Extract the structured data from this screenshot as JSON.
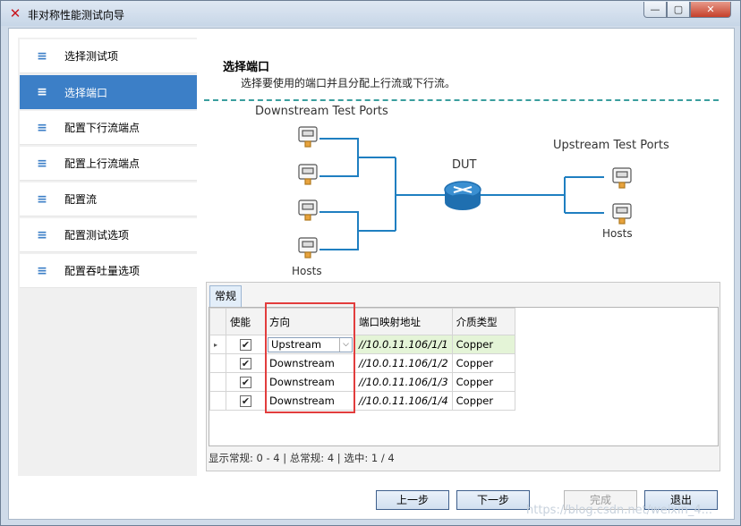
{
  "window": {
    "title": "非对称性能测试向导",
    "minimize": "—",
    "maximize": "▢",
    "close": "✕"
  },
  "sidebar": {
    "items": [
      {
        "label": "选择测试项"
      },
      {
        "label": "选择端口"
      },
      {
        "label": "配置下行流端点"
      },
      {
        "label": "配置上行流端点"
      },
      {
        "label": "配置流"
      },
      {
        "label": "配置测试选项"
      },
      {
        "label": "配置吞吐量选项"
      }
    ],
    "active_index": 1
  },
  "main": {
    "section_title": "选择端口",
    "section_desc": "选择要使用的端口并且分配上行流或下行流。",
    "diagram": {
      "downstream_label": "Downstream Test Ports",
      "upstream_label": "Upstream Test Ports",
      "dut_label": "DUT",
      "hosts_left": "Hosts",
      "hosts_right": "Hosts"
    },
    "tab": "常规",
    "grid": {
      "headers": [
        "使能",
        "方向",
        "端口映射地址",
        "介质类型"
      ],
      "rows": [
        {
          "enabled": true,
          "direction": "Upstream",
          "address": "//10.0.11.106/1/1",
          "media": "Copper",
          "selected": true
        },
        {
          "enabled": true,
          "direction": "Downstream",
          "address": "//10.0.11.106/1/2",
          "media": "Copper"
        },
        {
          "enabled": true,
          "direction": "Downstream",
          "address": "//10.0.11.106/1/3",
          "media": "Copper"
        },
        {
          "enabled": true,
          "direction": "Downstream",
          "address": "//10.0.11.106/1/4",
          "media": "Copper"
        }
      ]
    },
    "status": "显示常规: 0 - 4 | 总常规: 4 | 选中: 1 / 4"
  },
  "footer": {
    "prev": "上一步",
    "next": "下一步",
    "finish": "完成",
    "exit": "退出"
  },
  "watermark": "https://blog.csdn.net/weixin_4..."
}
